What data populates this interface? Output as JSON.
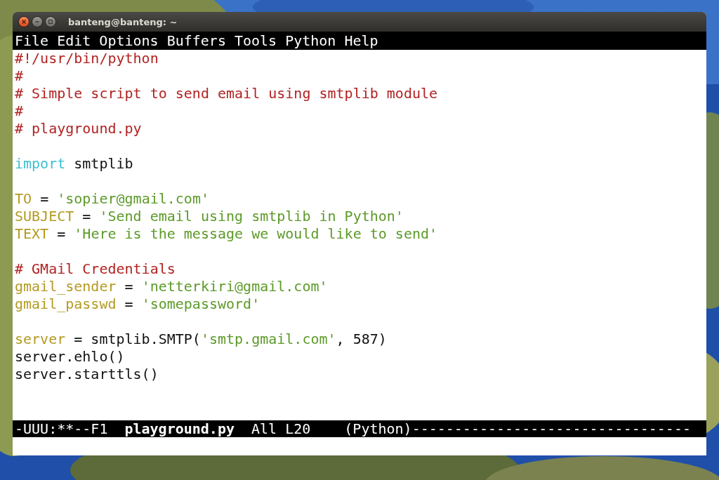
{
  "window": {
    "title": "banteng@banteng: ~"
  },
  "menu_bar": [
    "File",
    "Edit",
    "Options",
    "Buffers",
    "Tools",
    "Python",
    "Help"
  ],
  "editor": {
    "lines": [
      {
        "space_before": false,
        "tokens": [
          {
            "kind": "comment",
            "text": "#!/usr/bin/python"
          }
        ]
      },
      {
        "space_before": false,
        "tokens": [
          {
            "kind": "comment",
            "text": "#"
          }
        ]
      },
      {
        "space_before": false,
        "tokens": [
          {
            "kind": "comment",
            "text": "# Simple script to send email using smtplib module"
          }
        ]
      },
      {
        "space_before": false,
        "tokens": [
          {
            "kind": "comment",
            "text": "#"
          }
        ]
      },
      {
        "space_before": false,
        "tokens": [
          {
            "kind": "comment",
            "text": "# playground.py"
          }
        ]
      },
      {
        "space_before": true,
        "tokens": [
          {
            "kind": "keyword",
            "text": "import"
          },
          {
            "kind": "plain",
            "text": " smtplib"
          }
        ]
      },
      {
        "space_before": true,
        "tokens": [
          {
            "kind": "variable",
            "text": "TO"
          },
          {
            "kind": "plain",
            "text": " = "
          },
          {
            "kind": "string",
            "text": "'sopier@gmail.com'"
          }
        ]
      },
      {
        "space_before": false,
        "tokens": [
          {
            "kind": "variable",
            "text": "SUBJECT"
          },
          {
            "kind": "plain",
            "text": " = "
          },
          {
            "kind": "string",
            "text": "'Send email using smtplib in Python'"
          }
        ]
      },
      {
        "space_before": false,
        "tokens": [
          {
            "kind": "variable",
            "text": "TEXT"
          },
          {
            "kind": "plain",
            "text": " = "
          },
          {
            "kind": "string",
            "text": "'Here is the message we would like to send'"
          }
        ]
      },
      {
        "space_before": true,
        "tokens": [
          {
            "kind": "comment",
            "text": "# GMail Credentials"
          }
        ]
      },
      {
        "space_before": false,
        "tokens": [
          {
            "kind": "variable",
            "text": "gmail_sender"
          },
          {
            "kind": "plain",
            "text": " = "
          },
          {
            "kind": "string",
            "text": "'netterkiri@gmail.com'"
          }
        ]
      },
      {
        "space_before": false,
        "tokens": [
          {
            "kind": "variable",
            "text": "gmail_passwd"
          },
          {
            "kind": "plain",
            "text": " = "
          },
          {
            "kind": "string",
            "text": "'somepassword'"
          }
        ]
      },
      {
        "space_before": true,
        "tokens": [
          {
            "kind": "variable",
            "text": "server"
          },
          {
            "kind": "plain",
            "text": " = smtplib.SMTP("
          },
          {
            "kind": "string",
            "text": "'smtp.gmail.com'"
          },
          {
            "kind": "plain",
            "text": ", 587)"
          }
        ]
      },
      {
        "space_before": false,
        "tokens": [
          {
            "kind": "plain",
            "text": "server.ehlo()"
          }
        ]
      },
      {
        "space_before": false,
        "tokens": [
          {
            "kind": "plain",
            "text": "server.starttls()"
          }
        ]
      }
    ]
  },
  "mode_line": {
    "status": "-UUU:**--F1",
    "buffer_name": "playground.py",
    "position": "All L20",
    "major_mode": "(Python)---------------------------------"
  }
}
